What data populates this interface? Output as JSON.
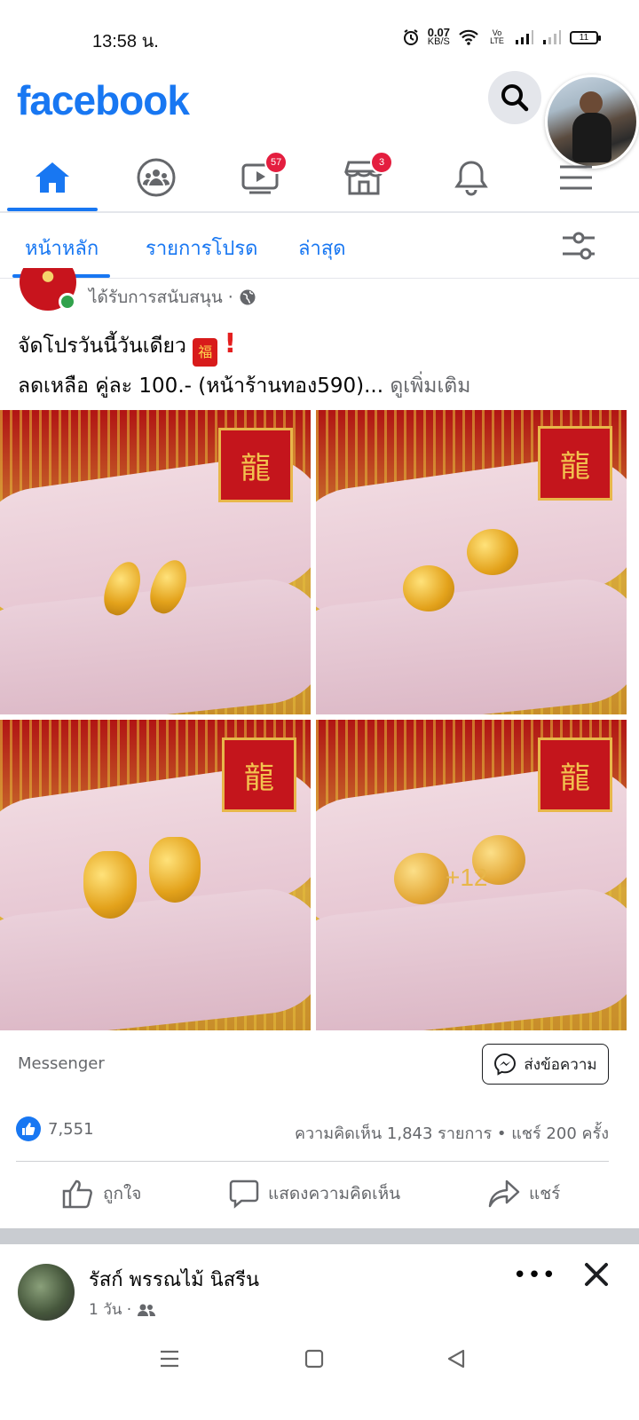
{
  "status_bar": {
    "time": "13:58 น.",
    "net_speed_value": "0.07",
    "net_speed_unit": "KB/S",
    "volte": "Vo LTE",
    "battery": "11"
  },
  "header": {
    "logo": "facebook",
    "search_icon": "search-icon"
  },
  "nav": {
    "items": [
      {
        "name": "home",
        "icon": "home-icon",
        "active": true
      },
      {
        "name": "groups",
        "icon": "groups-icon"
      },
      {
        "name": "watch",
        "icon": "watch-icon",
        "badge": "57"
      },
      {
        "name": "marketplace",
        "icon": "marketplace-icon",
        "badge": "3"
      },
      {
        "name": "notifications",
        "icon": "bell-icon"
      },
      {
        "name": "menu",
        "icon": "menu-icon"
      }
    ]
  },
  "feed_tabs": {
    "home": "หน้าหลัก",
    "favorites": "รายการโปรด",
    "recent": "ล่าสุด"
  },
  "post": {
    "sponsored": "ได้รับการสนับสนุน ·",
    "line1": "จัดโปรวันนี้วันเดียว",
    "line2": "ลดเหลือ คู่ละ 100.- (หน้าร้านทอง590)...",
    "see_more": "ดูเพิ่มเติม",
    "more_photos": "+12",
    "messenger_label": "Messenger",
    "send_message": "ส่งข้อความ",
    "like_count": "7,551",
    "stats": "ความคิดเห็น 1,843 รายการ • แชร์ 200 ครั้ง",
    "actions": {
      "like": "ถูกใจ",
      "comment": "แสดงความคิดเห็น",
      "share": "แชร์"
    }
  },
  "next_post": {
    "name": "รัสก์ พรรณไม้ นิสรีน",
    "time": "1 วัน ·"
  },
  "colors": {
    "brand": "#1877f2",
    "badge": "#e41e3f",
    "secondary_text": "#65676b"
  }
}
